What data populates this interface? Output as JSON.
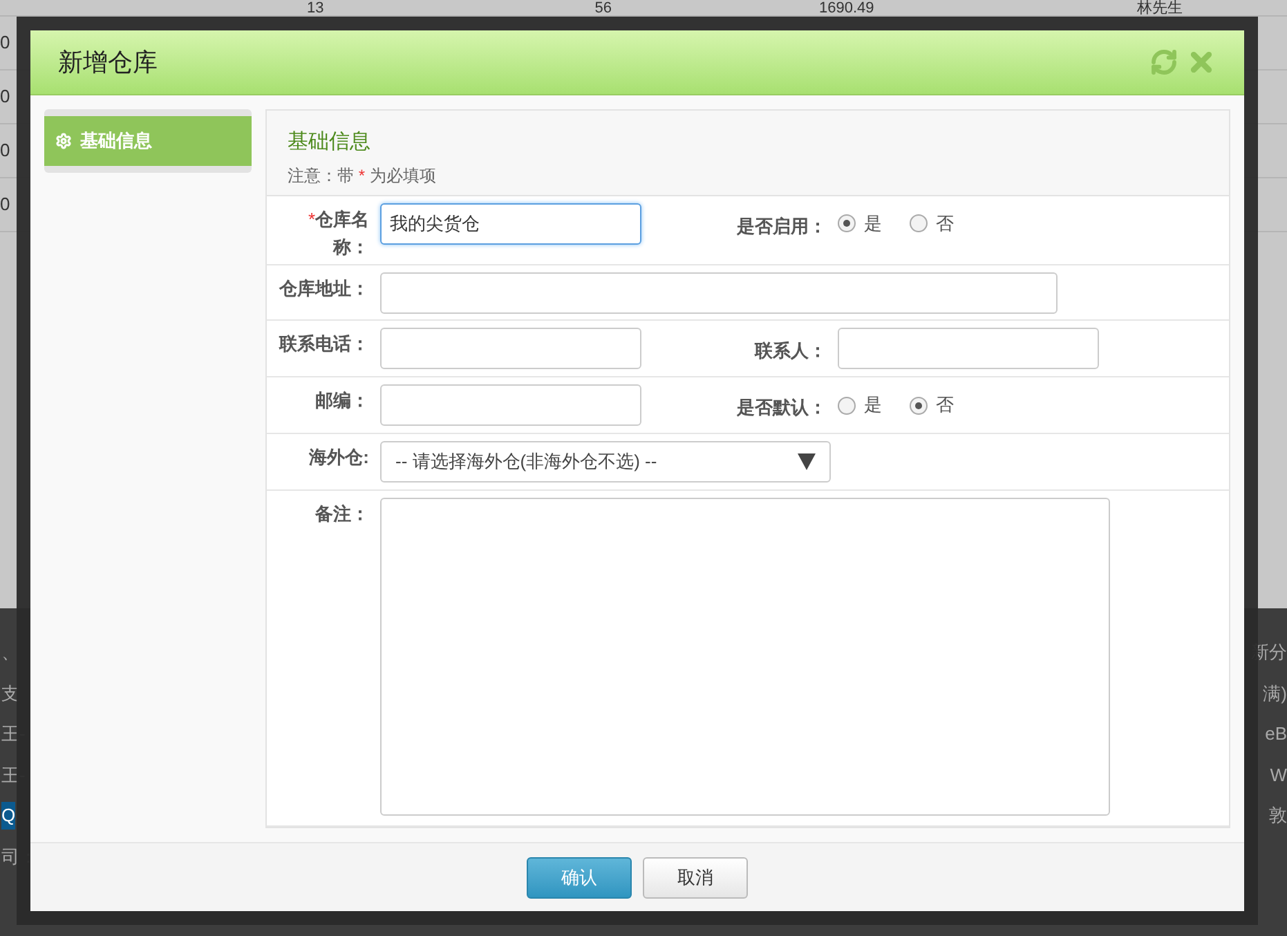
{
  "background": {
    "table_row": [
      "13",
      "56",
      "1690.49",
      "林先生"
    ],
    "row_edges": [
      "0",
      "0",
      "0",
      "0"
    ],
    "left_fragments": [
      "、",
      "支",
      "王-",
      "王-",
      "Q",
      "司："
    ],
    "right_fragments": [
      "新分",
      "满)",
      "eB",
      "W",
      "敦"
    ]
  },
  "dialog": {
    "title": "新增仓库",
    "sidebar": [
      {
        "label": "基础信息",
        "selected": true
      }
    ],
    "section": {
      "title": "基础信息",
      "note_before": "注意：带",
      "required_mark": "*",
      "note_after": "为必填项"
    },
    "rows": [
      {
        "kind": "pair",
        "label": "仓库名称：",
        "required_mark": "*",
        "value": "我的尖货仓",
        "focused": true,
        "right": {
          "kind": "radio",
          "label": "是否启用：",
          "options": [
            {
              "label": "是",
              "selected": true
            },
            {
              "label": "否",
              "selected": false
            }
          ]
        }
      },
      {
        "kind": "wide",
        "label": "仓库地址：",
        "focused": false
      },
      {
        "kind": "pair",
        "label": "联系电话：",
        "focused": false,
        "right": {
          "kind": "input",
          "label": "联系人："
        }
      },
      {
        "kind": "pair",
        "label": "邮编：",
        "focused": false,
        "right": {
          "kind": "radio",
          "label": "是否默认：",
          "options": [
            {
              "label": "是",
              "selected": false
            },
            {
              "label": "否",
              "selected": true
            }
          ]
        }
      },
      {
        "kind": "select",
        "label": "海外仓:",
        "value": "-- 请选择海外仓(非海外仓不选) --"
      },
      {
        "kind": "textarea",
        "label": "备注："
      }
    ],
    "buttons": [
      {
        "label": "确认",
        "kind": "primary"
      },
      {
        "label": "取消",
        "kind": "secondary"
      }
    ]
  }
}
